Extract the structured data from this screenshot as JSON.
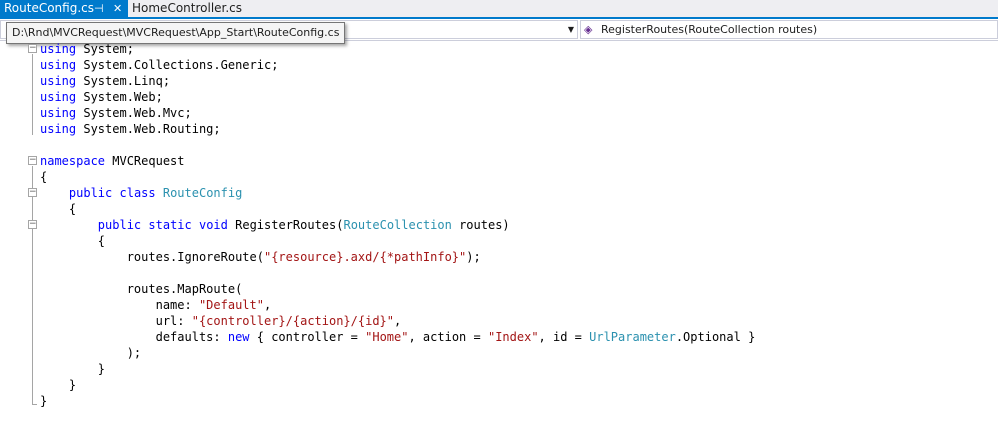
{
  "tabs": [
    {
      "label": "RouteConfig.cs",
      "active": true,
      "pin_icon": "pin-icon",
      "close_icon": "close-icon"
    },
    {
      "label": "HomeController.cs",
      "active": false
    }
  ],
  "navbar": {
    "left_dropdown": "",
    "right_dropdown": "RegisterRoutes(RouteCollection routes)",
    "right_icon": "method-icon"
  },
  "tooltip": "D:\\Rnd\\MVCRequest\\MVCRequest\\App_Start\\RouteConfig.cs",
  "colors": {
    "accent": "#007acc",
    "keyword": "#0000ff",
    "type": "#2b91af",
    "string": "#a31515"
  },
  "code": [
    [
      {
        "t": "using",
        "k": "kw"
      },
      {
        "t": " System;"
      }
    ],
    [
      {
        "t": "using",
        "k": "kw"
      },
      {
        "t": " System.Collections.Generic;"
      }
    ],
    [
      {
        "t": "using",
        "k": "kw"
      },
      {
        "t": " System.Linq;"
      }
    ],
    [
      {
        "t": "using",
        "k": "kw"
      },
      {
        "t": " System.Web;"
      }
    ],
    [
      {
        "t": "using",
        "k": "kw"
      },
      {
        "t": " System.Web.Mvc;"
      }
    ],
    [
      {
        "t": "using",
        "k": "kw"
      },
      {
        "t": " System.Web.Routing;"
      }
    ],
    [],
    [
      {
        "t": "namespace",
        "k": "kw"
      },
      {
        "t": " MVCRequest"
      }
    ],
    [
      {
        "t": "{"
      }
    ],
    [
      {
        "t": "    "
      },
      {
        "t": "public",
        "k": "kw"
      },
      {
        "t": " "
      },
      {
        "t": "class",
        "k": "kw"
      },
      {
        "t": " "
      },
      {
        "t": "RouteConfig",
        "k": "ty"
      }
    ],
    [
      {
        "t": "    {"
      }
    ],
    [
      {
        "t": "        "
      },
      {
        "t": "public",
        "k": "kw"
      },
      {
        "t": " "
      },
      {
        "t": "static",
        "k": "kw"
      },
      {
        "t": " "
      },
      {
        "t": "void",
        "k": "kw"
      },
      {
        "t": " RegisterRoutes("
      },
      {
        "t": "RouteCollection",
        "k": "ty"
      },
      {
        "t": " routes)"
      }
    ],
    [
      {
        "t": "        {"
      }
    ],
    [
      {
        "t": "            routes.IgnoreRoute("
      },
      {
        "t": "\"{resource}.axd/{*pathInfo}\"",
        "k": "st"
      },
      {
        "t": ");"
      }
    ],
    [],
    [
      {
        "t": "            routes.MapRoute("
      }
    ],
    [
      {
        "t": "                name: "
      },
      {
        "t": "\"Default\"",
        "k": "st"
      },
      {
        "t": ","
      }
    ],
    [
      {
        "t": "                url: "
      },
      {
        "t": "\"{controller}/{action}/{id}\"",
        "k": "st"
      },
      {
        "t": ","
      }
    ],
    [
      {
        "t": "                defaults: "
      },
      {
        "t": "new",
        "k": "kw"
      },
      {
        "t": " { controller = "
      },
      {
        "t": "\"Home\"",
        "k": "st"
      },
      {
        "t": ", action = "
      },
      {
        "t": "\"Index\"",
        "k": "st"
      },
      {
        "t": ", id = "
      },
      {
        "t": "UrlParameter",
        "k": "ty"
      },
      {
        "t": ".Optional }"
      }
    ],
    [
      {
        "t": "            );"
      }
    ],
    [
      {
        "t": "        }"
      }
    ],
    [
      {
        "t": "    }"
      }
    ],
    [
      {
        "t": "}"
      }
    ]
  ]
}
